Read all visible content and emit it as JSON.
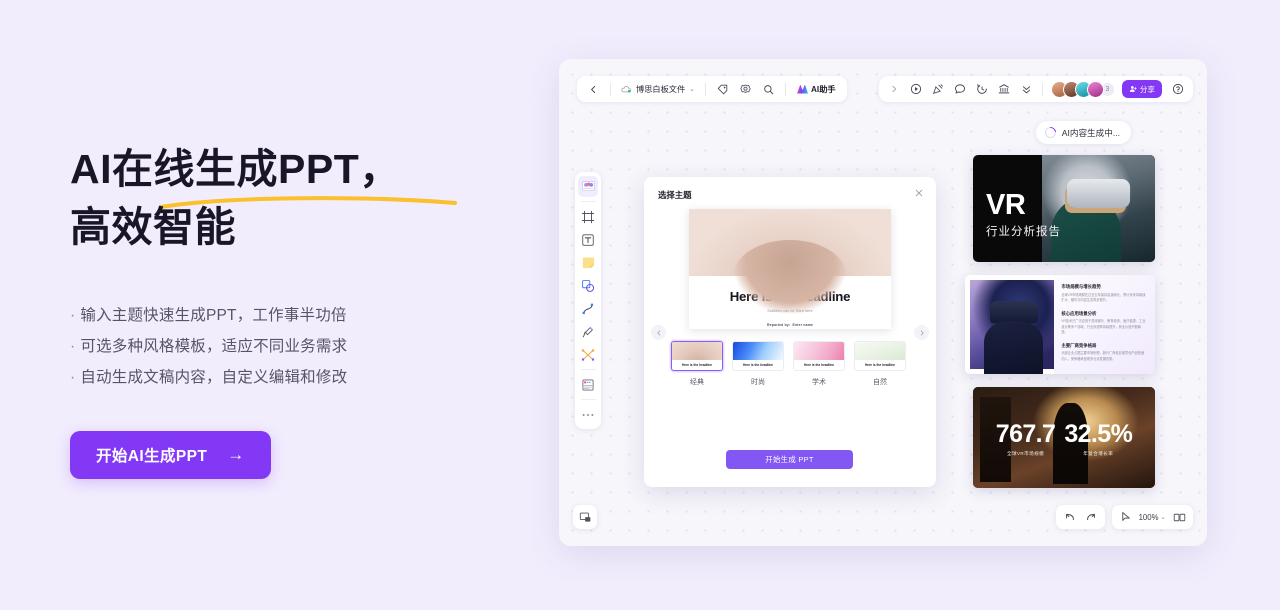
{
  "theme_colors": {
    "page_bg": "#f2edfd",
    "accent": "#8338f5",
    "headline": "#191627",
    "underline": "#fbc02d",
    "canvas_bg": "#f7f6fb"
  },
  "marketing": {
    "headline_line1": "AI在线生成PPT，",
    "headline_line2": "高效智能",
    "bullets": [
      "输入主题快速生成PPT，工作事半功倍",
      "可选多种风格模板，适应不同业务需求",
      "自动生成文稿内容，自定义编辑和修改"
    ],
    "bullet_marker": "·",
    "cta_label": "开始AI生成PPT",
    "cta_arrow": "→"
  },
  "app": {
    "toolbar_left": {
      "back_icon": "chevron-left-icon",
      "cloud_icon": "cloud-save-icon",
      "doc_name": "博思白板文件",
      "doc_caret": "⌄",
      "icons": [
        "tag-icon",
        "settings-gear-icon",
        "search-icon"
      ],
      "ai_assistant_label": "AI助手",
      "ai_assistant_icon": "ai-sparkle-icon"
    },
    "toolbar_right": {
      "expand_icon": "chevron-right-icon",
      "icons": [
        "play-circle-icon",
        "presentation-pointer-icon",
        "comment-icon",
        "history-clock-icon",
        "bank-template-icon",
        "collapse-chevrons-icon"
      ],
      "avatar_colors": [
        "#c98b6b",
        "#8e5e4a",
        "#2cb7c4",
        "#d858b6"
      ],
      "avatar_extra_count": "3",
      "share_label": "分享",
      "share_icon": "share-person-icon",
      "help_icon": "help-circle-icon"
    },
    "ai_status": {
      "label": "AI内容生成中...",
      "spinner_icon": "loading-spinner-icon"
    },
    "tool_rail": [
      {
        "name": "template-library-icon",
        "selected": true
      },
      {
        "name": "frame-icon",
        "selected": false
      },
      {
        "name": "text-icon",
        "selected": false
      },
      {
        "name": "sticky-note-icon",
        "selected": false
      },
      {
        "name": "shapes-icon",
        "selected": false
      },
      {
        "name": "curve-pen-icon",
        "selected": false
      },
      {
        "name": "marker-pen-icon",
        "selected": false
      },
      {
        "name": "mindmap-connector-icon",
        "selected": false
      },
      {
        "name": "document-table-icon",
        "selected": false
      },
      {
        "name": "more-tools-icon",
        "selected": false
      }
    ],
    "bottom_left": {
      "icon": "frame-capture-icon"
    },
    "bottom_right": {
      "undo_icon": "undo-arrow-icon",
      "redo_icon": "redo-arrow-icon",
      "pointer_icon": "presenter-pointer-icon",
      "zoom_level": "100%",
      "zoom_caret": "⌄",
      "presentation_icon": "book-presentation-icon"
    }
  },
  "dialog": {
    "title": "选择主题",
    "close_icon": "close-icon",
    "prev_icon": "chevron-left-icon",
    "next_icon": "chevron-right-icon",
    "slide_preview": {
      "headline": "Here is the headline",
      "subtitle": "Subtitles can be filled here",
      "byline": "Reported by：Enter name"
    },
    "themes": [
      {
        "label": "经典",
        "caption": "Here is the headline",
        "selected": true
      },
      {
        "label": "时尚",
        "caption": "Here is the headline",
        "selected": false
      },
      {
        "label": "学术",
        "caption": "Here is the headline",
        "selected": false
      },
      {
        "label": "自然",
        "caption": "Here is the headline",
        "selected": false
      }
    ],
    "generate_label": "开始生成 PPT"
  },
  "generated_cards": {
    "card1": {
      "title": "VR",
      "subtitle": "行业分析报告"
    },
    "card2": {
      "sections": [
        {
          "heading": "市场规模与增长趋势",
          "body": "全球VR市场规模在过去五年保持高速增长，预计未来将继续扩大，硬件与内容生态同步提升。"
        },
        {
          "heading": "核心应用场景分析",
          "body": "VR技术已广泛应用于游戏娱乐、教育培训、医疗健康、工业设计等多个领域，行业渗透率持续提升，商业价值不断释放。"
        },
        {
          "heading": "主要厂商竞争格局",
          "body": "头部企业占据主要市场份额，新兴厂商依靠差异化产品快速切入，竞争格局呈现多元化发展态势。"
        }
      ]
    },
    "card3": {
      "stats": [
        {
          "value": "767.7",
          "label": "全球VR市场规模"
        },
        {
          "value": "32.5%",
          "label": "年复合增长率"
        }
      ]
    }
  }
}
